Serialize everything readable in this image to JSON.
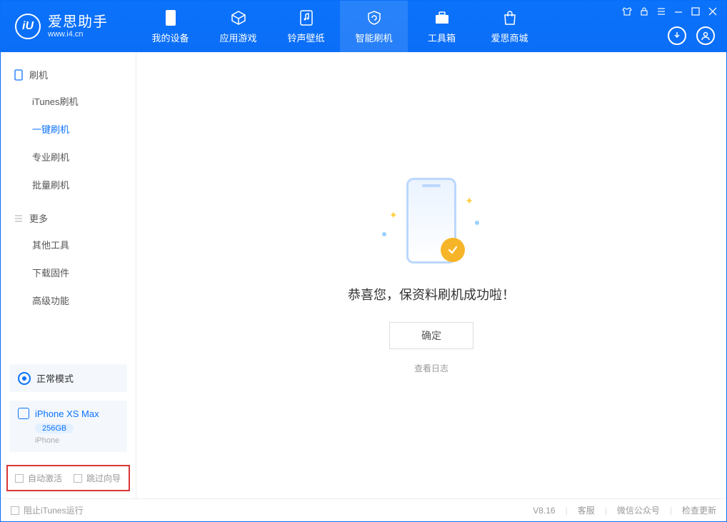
{
  "header": {
    "logo_text": "爱思助手",
    "logo_sub": "www.i4.cn",
    "tabs": [
      {
        "label": "我的设备"
      },
      {
        "label": "应用游戏"
      },
      {
        "label": "铃声壁纸"
      },
      {
        "label": "智能刷机"
      },
      {
        "label": "工具箱"
      },
      {
        "label": "爱思商城"
      }
    ]
  },
  "sidebar": {
    "section1_title": "刷机",
    "items1": [
      {
        "label": "iTunes刷机"
      },
      {
        "label": "一键刷机"
      },
      {
        "label": "专业刷机"
      },
      {
        "label": "批量刷机"
      }
    ],
    "section2_title": "更多",
    "items2": [
      {
        "label": "其他工具"
      },
      {
        "label": "下载固件"
      },
      {
        "label": "高级功能"
      }
    ],
    "mode_card": "正常模式",
    "device": {
      "name": "iPhone XS Max",
      "storage": "256GB",
      "type": "iPhone"
    },
    "checkbox1": "自动激活",
    "checkbox2": "跳过向导"
  },
  "main": {
    "success_text": "恭喜您，保资料刷机成功啦！",
    "ok_button": "确定",
    "log_link": "查看日志"
  },
  "footer": {
    "stop_itunes": "阻止iTunes运行",
    "version": "V8.16",
    "link1": "客服",
    "link2": "微信公众号",
    "link3": "检查更新"
  }
}
